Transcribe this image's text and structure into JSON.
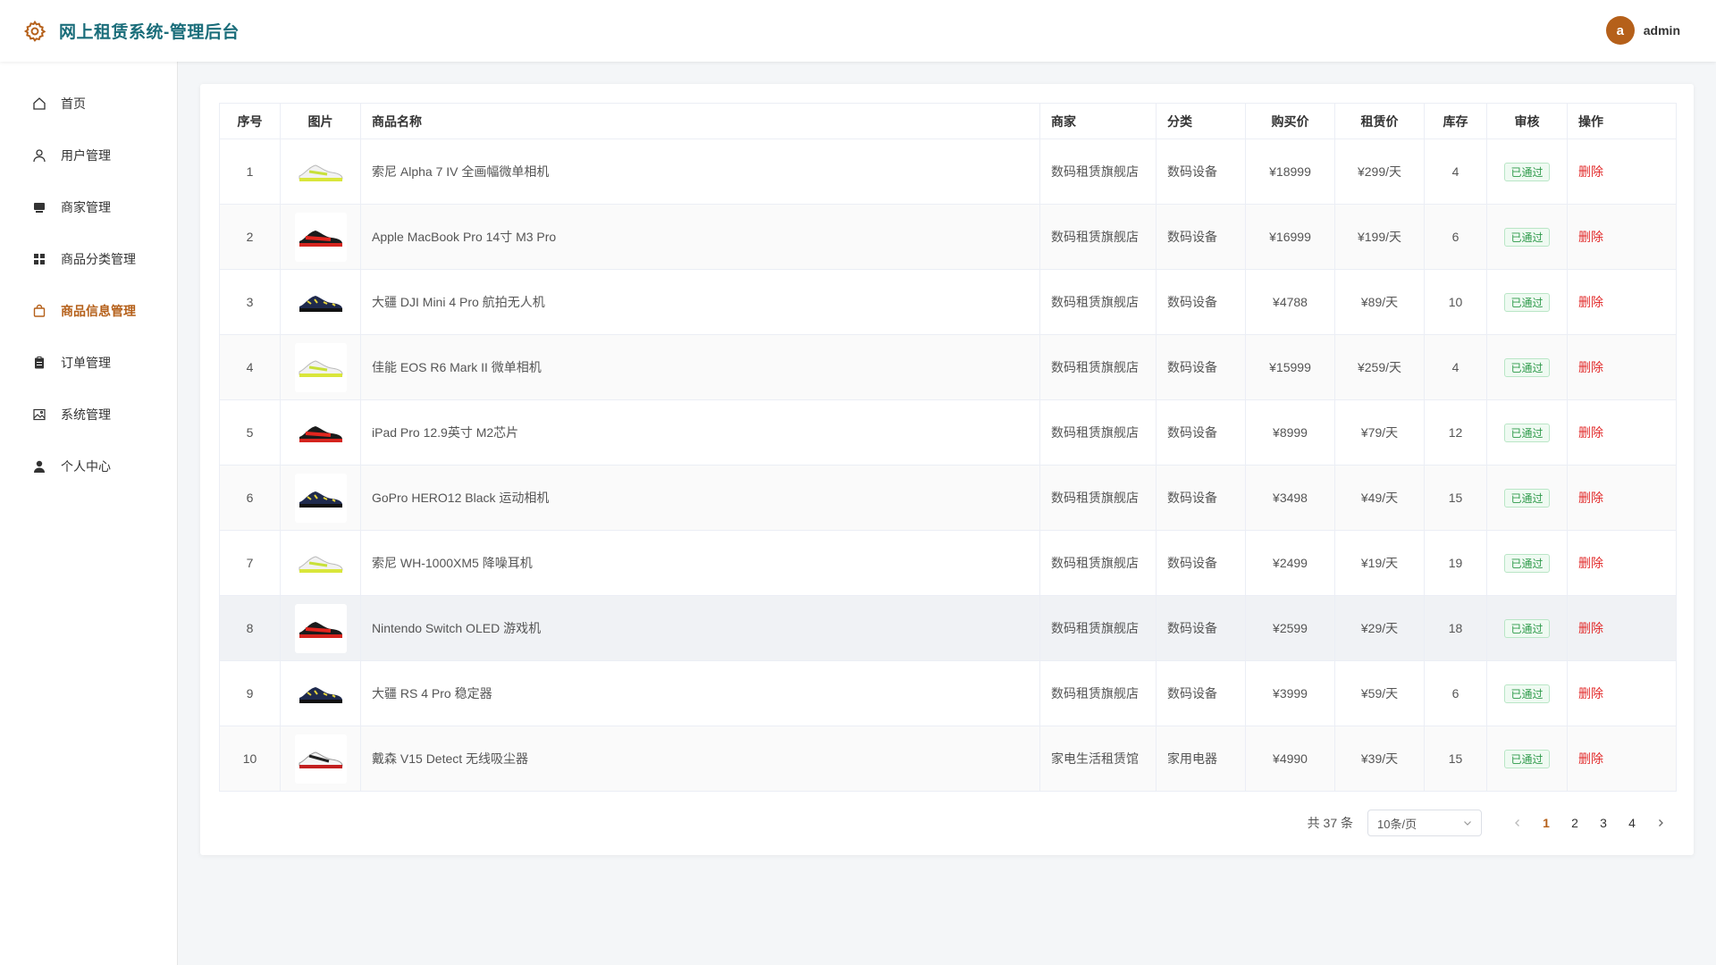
{
  "header": {
    "title": "网上租赁系统-管理后台",
    "avatar_letter": "a",
    "username": "admin"
  },
  "sidebar": {
    "items": [
      {
        "label": "首页",
        "icon": "home-icon"
      },
      {
        "label": "用户管理",
        "icon": "user-outline-icon"
      },
      {
        "label": "商家管理",
        "icon": "shop-icon"
      },
      {
        "label": "商品分类管理",
        "icon": "grid-icon"
      },
      {
        "label": "商品信息管理",
        "icon": "bag-icon",
        "active": true
      },
      {
        "label": "订单管理",
        "icon": "clipboard-icon"
      },
      {
        "label": "系统管理",
        "icon": "image-icon"
      },
      {
        "label": "个人中心",
        "icon": "user-filled-icon"
      }
    ]
  },
  "table": {
    "headers": [
      "序号",
      "图片",
      "商品名称",
      "商家",
      "分类",
      "购买价",
      "租赁价",
      "库存",
      "审核",
      "操作"
    ],
    "rows": [
      {
        "no": "1",
        "name": "索尼 Alpha 7 IV 全画幅微单相机",
        "merchant": "数码租赁旗舰店",
        "category": "数码设备",
        "buy": "¥18999",
        "rent": "¥299/天",
        "stock": "4",
        "status": "已通过",
        "action": "删除",
        "img": "white"
      },
      {
        "no": "2",
        "name": "Apple MacBook Pro 14寸 M3 Pro",
        "merchant": "数码租赁旗舰店",
        "category": "数码设备",
        "buy": "¥16999",
        "rent": "¥199/天",
        "stock": "6",
        "status": "已通过",
        "action": "删除",
        "img": "red"
      },
      {
        "no": "3",
        "name": "大疆 DJI Mini 4 Pro 航拍无人机",
        "merchant": "数码租赁旗舰店",
        "category": "数码设备",
        "buy": "¥4788",
        "rent": "¥89/天",
        "stock": "10",
        "status": "已通过",
        "action": "删除",
        "img": "navy"
      },
      {
        "no": "4",
        "name": "佳能 EOS R6 Mark II 微单相机",
        "merchant": "数码租赁旗舰店",
        "category": "数码设备",
        "buy": "¥15999",
        "rent": "¥259/天",
        "stock": "4",
        "status": "已通过",
        "action": "删除",
        "img": "white"
      },
      {
        "no": "5",
        "name": "iPad Pro 12.9英寸 M2芯片",
        "merchant": "数码租赁旗舰店",
        "category": "数码设备",
        "buy": "¥8999",
        "rent": "¥79/天",
        "stock": "12",
        "status": "已通过",
        "action": "删除",
        "img": "red"
      },
      {
        "no": "6",
        "name": "GoPro HERO12 Black 运动相机",
        "merchant": "数码租赁旗舰店",
        "category": "数码设备",
        "buy": "¥3498",
        "rent": "¥49/天",
        "stock": "15",
        "status": "已通过",
        "action": "删除",
        "img": "navy"
      },
      {
        "no": "7",
        "name": "索尼 WH-1000XM5 降噪耳机",
        "merchant": "数码租赁旗舰店",
        "category": "数码设备",
        "buy": "¥2499",
        "rent": "¥19/天",
        "stock": "19",
        "status": "已通过",
        "action": "删除",
        "img": "white"
      },
      {
        "no": "8",
        "name": "Nintendo Switch OLED 游戏机",
        "merchant": "数码租赁旗舰店",
        "category": "数码设备",
        "buy": "¥2599",
        "rent": "¥29/天",
        "stock": "18",
        "status": "已通过",
        "action": "删除",
        "img": "red"
      },
      {
        "no": "9",
        "name": "大疆 RS 4 Pro 稳定器",
        "merchant": "数码租赁旗舰店",
        "category": "数码设备",
        "buy": "¥3999",
        "rent": "¥59/天",
        "stock": "6",
        "status": "已通过",
        "action": "删除",
        "img": "navy"
      },
      {
        "no": "10",
        "name": "戴森 V15 Detect 无线吸尘器",
        "merchant": "家电生活租赁馆",
        "category": "家用电器",
        "buy": "¥4990",
        "rent": "¥39/天",
        "stock": "15",
        "status": "已通过",
        "action": "删除",
        "img": "whiteblack"
      }
    ]
  },
  "pagination": {
    "total": "共 37 条",
    "page_size": "10条/页",
    "pages": [
      "1",
      "2",
      "3",
      "4"
    ],
    "current": "1"
  },
  "colors": {
    "accent": "#b5601a",
    "title": "#1a6d7a",
    "approved": "#2e9a4a",
    "delete": "#e22c2c"
  }
}
